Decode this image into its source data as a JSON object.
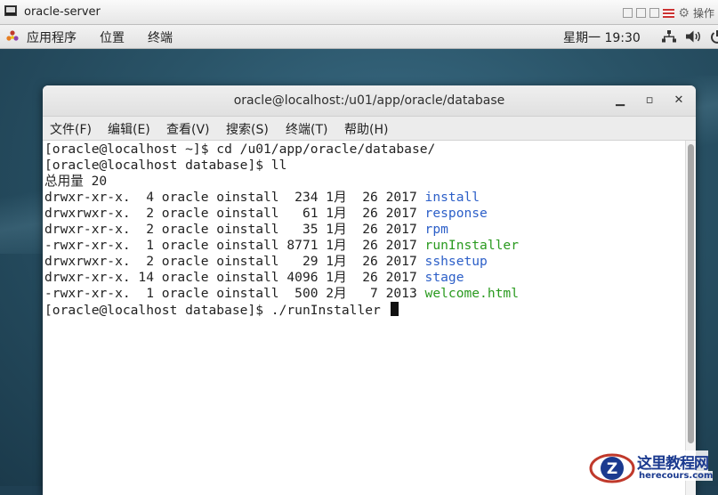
{
  "vm_window": {
    "title": "oracle-server",
    "actions_label": "操作"
  },
  "top_panel": {
    "menus": [
      "应用程序",
      "位置",
      "终端"
    ],
    "clock": "星期一 19:30"
  },
  "terminal": {
    "title": "oracle@localhost:/u01/app/oracle/database",
    "menubar": [
      "文件(F)",
      "编辑(E)",
      "查看(V)",
      "搜索(S)",
      "终端(T)",
      "帮助(H)"
    ],
    "prompt_lines": [
      "[oracle@localhost ~]$ cd /u01/app/oracle/database/",
      "[oracle@localhost database]$ ll",
      "总用量 20"
    ],
    "listing": [
      {
        "meta": "drwxr-xr-x.  4 oracle oinstall  234 1月  26 2017 ",
        "name": "install",
        "color": "#2c5fc8"
      },
      {
        "meta": "drwxrwxr-x.  2 oracle oinstall   61 1月  26 2017 ",
        "name": "response",
        "color": "#2c5fc8"
      },
      {
        "meta": "drwxr-xr-x.  2 oracle oinstall   35 1月  26 2017 ",
        "name": "rpm",
        "color": "#2c5fc8"
      },
      {
        "meta": "-rwxr-xr-x.  1 oracle oinstall 8771 1月  26 2017 ",
        "name": "runInstaller",
        "color": "#2a9a1f"
      },
      {
        "meta": "drwxrwxr-x.  2 oracle oinstall   29 1月  26 2017 ",
        "name": "sshsetup",
        "color": "#2c5fc8"
      },
      {
        "meta": "drwxr-xr-x. 14 oracle oinstall 4096 1月  26 2017 ",
        "name": "stage",
        "color": "#2c5fc8"
      },
      {
        "meta": "-rwxr-xr-x.  1 oracle oinstall  500 2月   7 2013 ",
        "name": "welcome.html",
        "color": "#2a9a1f"
      }
    ],
    "current_command": "[oracle@localhost database]$ ./runInstaller "
  },
  "watermark": {
    "cn": "这里教程网",
    "en": "herecours.com"
  }
}
